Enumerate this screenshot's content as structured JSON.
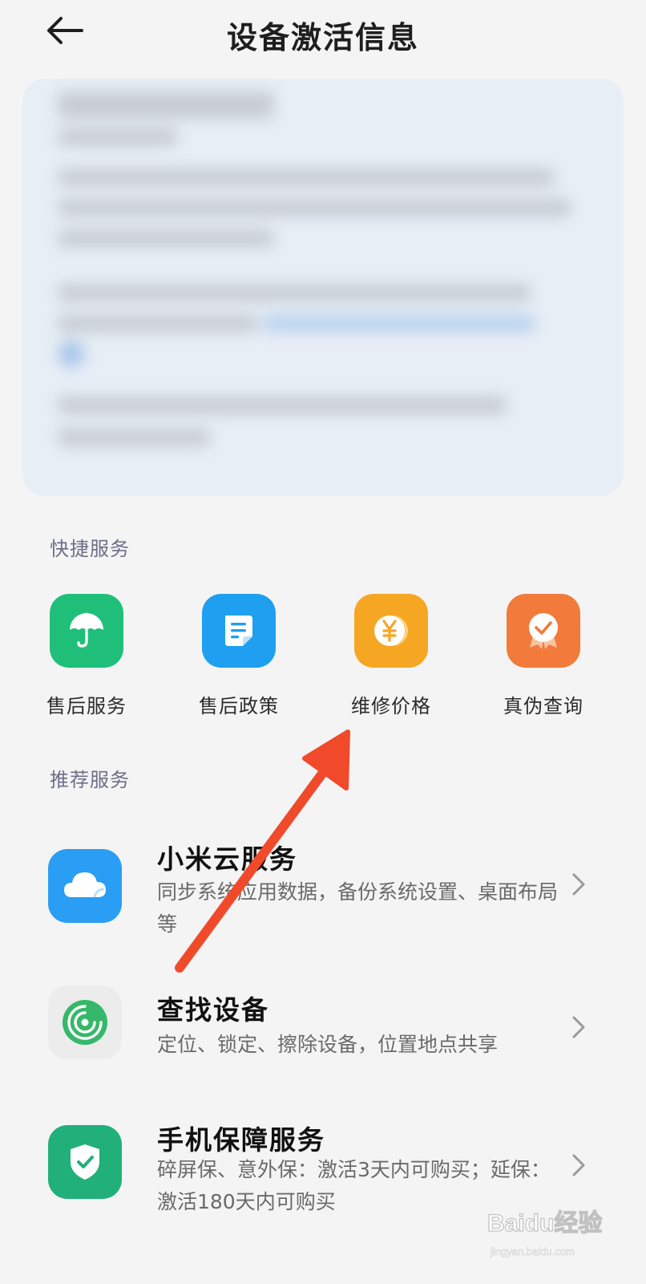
{
  "header": {
    "title": "设备激活信息"
  },
  "quick_services": {
    "title": "快捷服务",
    "items": [
      {
        "label": "售后服务",
        "icon": "umbrella-icon",
        "color": "#1fbf7a"
      },
      {
        "label": "售后政策",
        "icon": "document-icon",
        "color": "#1e9ff0"
      },
      {
        "label": "维修价格",
        "icon": "yuan-coin-icon",
        "color": "#f5a623"
      },
      {
        "label": "真伪查询",
        "icon": "verified-badge-icon",
        "color": "#f27a3a"
      }
    ]
  },
  "recommended_services": {
    "title": "推荐服务",
    "items": [
      {
        "title": "小米云服务",
        "desc": "同步系统应用数据，备份系统设置、桌面布局等",
        "icon": "cloud-icon",
        "color": "#2a9df4"
      },
      {
        "title": "查找设备",
        "desc": "定位、锁定、擦除设备，位置地点共享",
        "icon": "radar-icon",
        "color": "#35b86a"
      },
      {
        "title": "手机保障服务",
        "desc": "碎屏保、意外保：激活3天内可购买；延保：激活180天内可购买",
        "icon": "shield-check-icon",
        "color": "#21b07a"
      }
    ]
  },
  "watermark": {
    "text": "Baidu经验",
    "subtext": "jingyan.baidu.com"
  }
}
